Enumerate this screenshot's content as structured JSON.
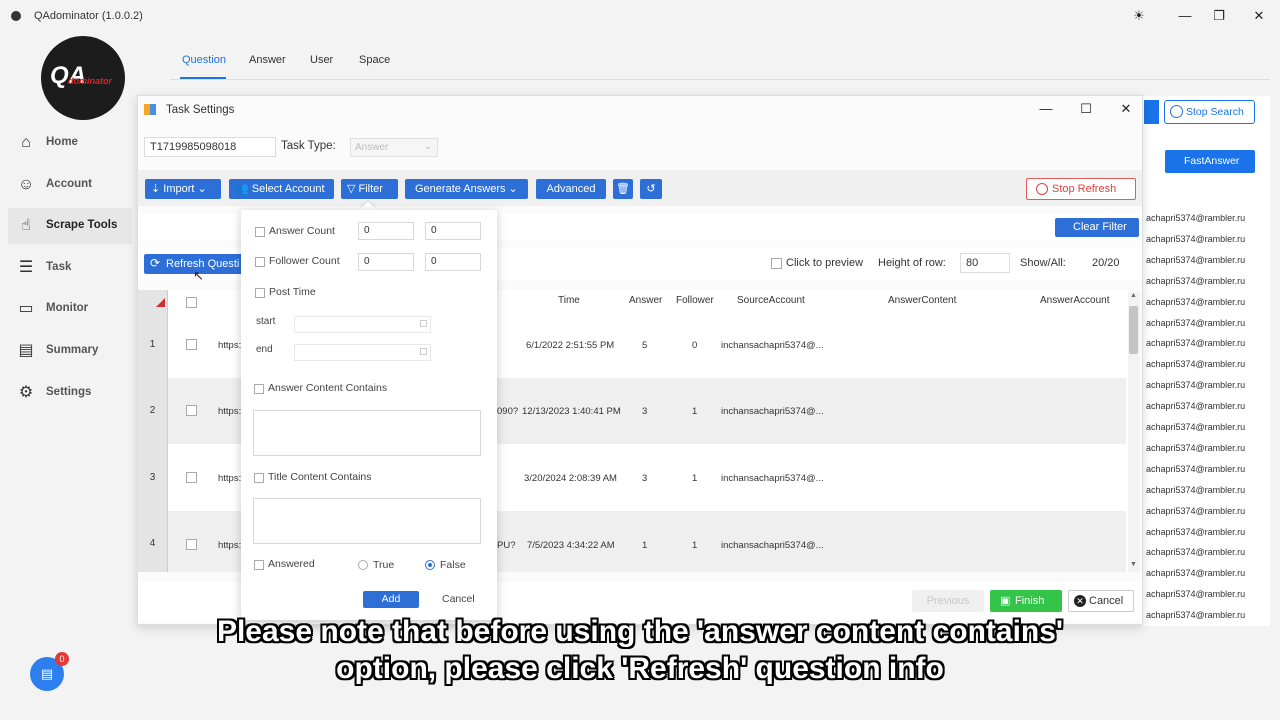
{
  "window": {
    "title": "QAdominator (1.0.0.2)"
  },
  "logo": {
    "q": "QA",
    "sub": "dominator"
  },
  "sidebar": {
    "items": [
      {
        "label": "Home",
        "icon": "home-icon"
      },
      {
        "label": "Account",
        "icon": "account-icon"
      },
      {
        "label": "Scrape Tools",
        "icon": "hand-icon",
        "active": true
      },
      {
        "label": "Task",
        "icon": "task-icon"
      },
      {
        "label": "Monitor",
        "icon": "monitor-icon"
      },
      {
        "label": "Summary",
        "icon": "summary-icon"
      },
      {
        "label": "Settings",
        "icon": "gear-icon"
      }
    ]
  },
  "main_tabs": [
    "Question",
    "Answer",
    "User",
    "Space"
  ],
  "right_panel": {
    "stop_search": "Stop Search",
    "fast_answer": "FastAnswer",
    "emails": [
      "achapri5374@rambler.ru",
      "achapri5374@rambler.ru",
      "achapri5374@rambler.ru",
      "achapri5374@rambler.ru",
      "achapri5374@rambler.ru",
      "achapri5374@rambler.ru",
      "achapri5374@rambler.ru",
      "achapri5374@rambler.ru",
      "achapri5374@rambler.ru",
      "achapri5374@rambler.ru",
      "achapri5374@rambler.ru",
      "achapri5374@rambler.ru",
      "achapri5374@rambler.ru",
      "achapri5374@rambler.ru",
      "achapri5374@rambler.ru",
      "achapri5374@rambler.ru",
      "achapri5374@rambler.ru",
      "achapri5374@rambler.ru",
      "achapri5374@rambler.ru",
      "achapri5374@rambler.ru"
    ]
  },
  "dialog": {
    "title": "Task Settings",
    "task_id": "T1719985098018",
    "task_type_label": "Task Type:",
    "task_type_value": "Answer",
    "toolbar": {
      "import": "Import",
      "select_account": "Select Account",
      "filter": "Filter",
      "generate_answers": "Generate Answers",
      "advanced": "Advanced",
      "stop_refresh": "Stop Refresh"
    },
    "clear_filter": "Clear Filter",
    "refresh_btn": "Refresh Questi",
    "click_to_preview": "Click to preview",
    "height_of_row_label": "Height of row:",
    "height_of_row_value": "80",
    "show_all_label": "Show/All:",
    "show_all_value": "20/20",
    "table": {
      "headers": [
        "Time",
        "Answer",
        "Follower",
        "SourceAccount",
        "AnswerContent",
        "AnswerAccount"
      ],
      "rows": [
        {
          "num": "1",
          "url": "https:/",
          "title_tail": "",
          "time": "6/1/2022 2:51:55 PM",
          "answer": "5",
          "follower": "0",
          "source": "inchansachapri5374@..."
        },
        {
          "num": "2",
          "url": "https:/",
          "title_tail": "090?",
          "time": "12/13/2023 1:40:41 PM",
          "answer": "3",
          "follower": "1",
          "source": "inchansachapri5374@..."
        },
        {
          "num": "3",
          "url": "https:/",
          "title_tail": "",
          "time": "3/20/2024 2:08:39 AM",
          "answer": "3",
          "follower": "1",
          "source": "inchansachapri5374@..."
        },
        {
          "num": "4",
          "url": "https:/",
          "title_tail": "PU?",
          "time": "7/5/2023 4:34:22 AM",
          "answer": "1",
          "follower": "1",
          "source": "inchansachapri5374@..."
        }
      ]
    },
    "buttons": {
      "previous": "Previous",
      "finish": "Finish",
      "cancel": "Cancel"
    }
  },
  "filter_popup": {
    "answer_count": {
      "label": "Answer Count",
      "min": "0",
      "max": "0"
    },
    "follower_count": {
      "label": "Follower Count",
      "min": "0",
      "max": "0"
    },
    "post_time": {
      "label": "Post Time",
      "start": "start",
      "end": "end"
    },
    "answer_content_contains": "Answer Content Contains",
    "title_content_contains": "Title Content Contains",
    "answered": {
      "label": "Answered",
      "true": "True",
      "false": "False",
      "selected": "False"
    },
    "add": "Add",
    "cancel": "Cancel"
  },
  "caption": {
    "line1": "Please note that before using the 'answer content contains'",
    "line2": "option, please click 'Refresh' question info"
  },
  "chat": {
    "badge": "0"
  }
}
